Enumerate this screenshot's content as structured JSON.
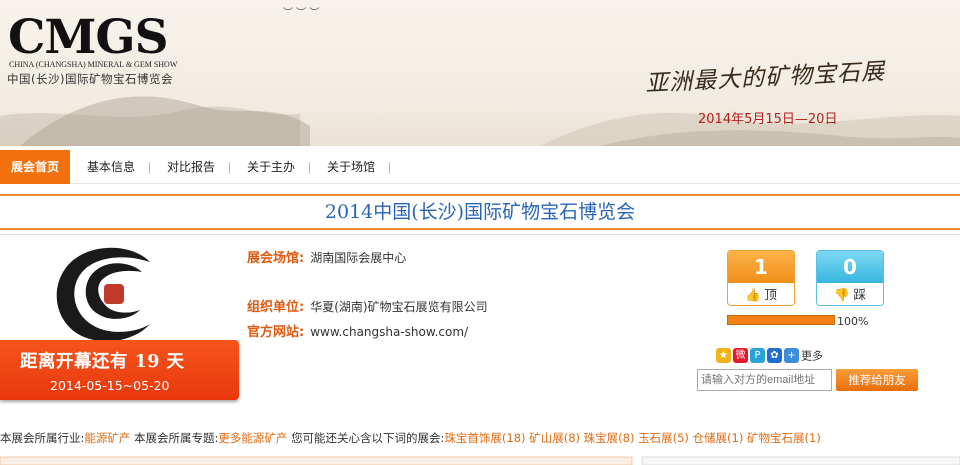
{
  "banner": {
    "logo_main": "CMGS",
    "logo_en": "CHINA (CHANGSHA) MINERAL & GEM SHOW",
    "logo_cn": "中国(长沙)国际矿物宝石博览会",
    "slogan": "亚洲最大的矿物宝石展",
    "date": "2014年5月15日—20日"
  },
  "nav": {
    "items": [
      {
        "label": "展会首页"
      },
      {
        "label": "基本信息"
      },
      {
        "label": "对比报告"
      },
      {
        "label": "关于主办"
      },
      {
        "label": "关于场馆"
      }
    ]
  },
  "page_title": "2014中国(长沙)国际矿物宝石博览会",
  "countdown": {
    "title": "距离开幕还有  19  天",
    "dates": "2014-05-15~05-20"
  },
  "details": {
    "venue_label": "展会场馆:",
    "venue_value": "湖南国际会展中心",
    "organizer_label": "组织单位:",
    "organizer_value": "华夏(湖南)矿物宝石展览有限公司",
    "website_label": "官方网站:",
    "website_value": "www.changsha-show.com/"
  },
  "votes": {
    "up_count": "1",
    "up_label": "顶",
    "down_count": "0",
    "down_label": "踩",
    "progress_percent": 100,
    "progress_text": "100%"
  },
  "share": {
    "more_label": "更多",
    "icons": [
      "qzone-icon",
      "weibo-icon",
      "tencent-weibo-icon",
      "renren-icon",
      "more-share-icon"
    ]
  },
  "recommend": {
    "email_placeholder": "请输入对方的email地址",
    "button_label": "推荐给朋友"
  },
  "footer_line": {
    "industry_label": "本展会所属行业:",
    "industry_value": "能源矿产",
    "topic_label": "本展会所属专题:",
    "topic_value": "更多能源矿产",
    "related_label": "您可能还关心含以下词的展会:",
    "related": [
      "珠宝首饰展(18)",
      "矿山展(8)",
      "珠宝展(8)",
      "玉石展(5)",
      "仓储展(1)",
      "矿物宝石展(1)"
    ]
  },
  "colors": {
    "accent_orange": "#f3710d",
    "title_blue": "#2a64b4",
    "countdown_red": "#e8380c"
  }
}
